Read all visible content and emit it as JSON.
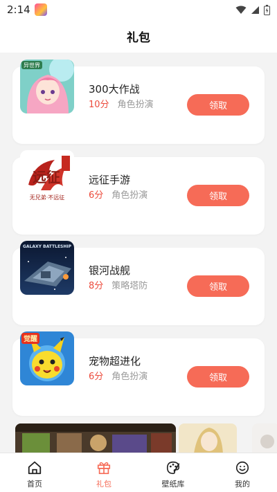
{
  "status_bar": {
    "time": "2:14"
  },
  "header": {
    "title": "礼包"
  },
  "games": [
    {
      "name": "300大作战",
      "score": "10分",
      "genre": "角色扮演",
      "button": "领取"
    },
    {
      "name": "远征手游",
      "score": "6分",
      "genre": "角色扮演",
      "button": "领取"
    },
    {
      "name": "银河战舰",
      "score": "8分",
      "genre": "策略塔防",
      "button": "领取"
    },
    {
      "name": "宠物超进化",
      "score": "6分",
      "genre": "角色扮演",
      "button": "领取"
    }
  ],
  "thumbnail_text": {
    "game1_badge": "异世界",
    "game2_logo": "远征",
    "game2_slogan": "无兄弟·不远征",
    "game3_logo": "GALAXY BATTLESHIP",
    "game4_badge": "觉醒"
  },
  "tabbar": {
    "items": [
      {
        "label": "首页",
        "icon": "home-icon"
      },
      {
        "label": "礼包",
        "icon": "gift-icon",
        "active": true
      },
      {
        "label": "壁纸库",
        "icon": "palette-icon"
      },
      {
        "label": "我的",
        "icon": "smiley-icon"
      }
    ]
  },
  "colors": {
    "accent": "#f66b57",
    "score": "#ec4a3b",
    "genre": "#999999",
    "background": "#f3f3f3"
  }
}
